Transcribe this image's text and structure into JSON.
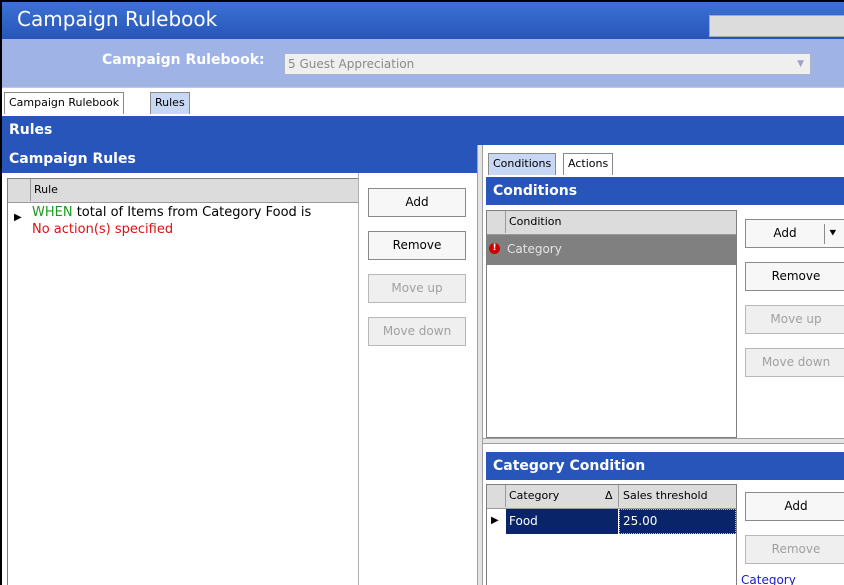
{
  "window": {
    "title": "Campaign Rulebook"
  },
  "selector": {
    "label": "Campaign Rulebook:",
    "value": "5 Guest Appreciation"
  },
  "tabs": [
    {
      "label": "Campaign Rulebook",
      "active": false
    },
    {
      "label": "Rules",
      "active": true
    }
  ],
  "section": {
    "title": "Rules"
  },
  "campaign_rules": {
    "title": "Campaign Rules",
    "column": "Rule",
    "rows": [
      {
        "when": "WHEN",
        "text": " total of Items from Category Food is",
        "action": "No action(s) specified"
      }
    ],
    "buttons": {
      "add": "Add",
      "remove": "Remove",
      "move_up": "Move up",
      "move_down": "Move down"
    }
  },
  "right_tabs": [
    {
      "label": "Conditions",
      "active": true
    },
    {
      "label": "Actions",
      "active": false
    }
  ],
  "conditions": {
    "title": "Conditions",
    "column": "Condition",
    "rows": [
      {
        "label": "Category"
      }
    ],
    "buttons": {
      "add": "Add",
      "remove": "Remove",
      "move_up": "Move up",
      "move_down": "Move down"
    }
  },
  "category_condition": {
    "title": "Category Condition",
    "columns": {
      "category": "Category",
      "sort_glyph": "Δ",
      "threshold": "Sales threshold"
    },
    "rows": [
      {
        "category": "Food",
        "threshold": "25.00"
      }
    ],
    "buttons": {
      "add": "Add",
      "remove": "Remove"
    },
    "link": "Category"
  },
  "colors": {
    "header_blue": "#2755b9",
    "selector_blue": "#9fb3e6",
    "when_green": "#1a9a1a",
    "warn_red": "#e01010",
    "selected_row": "#0a246a",
    "link_blue": "#1a1acc"
  }
}
